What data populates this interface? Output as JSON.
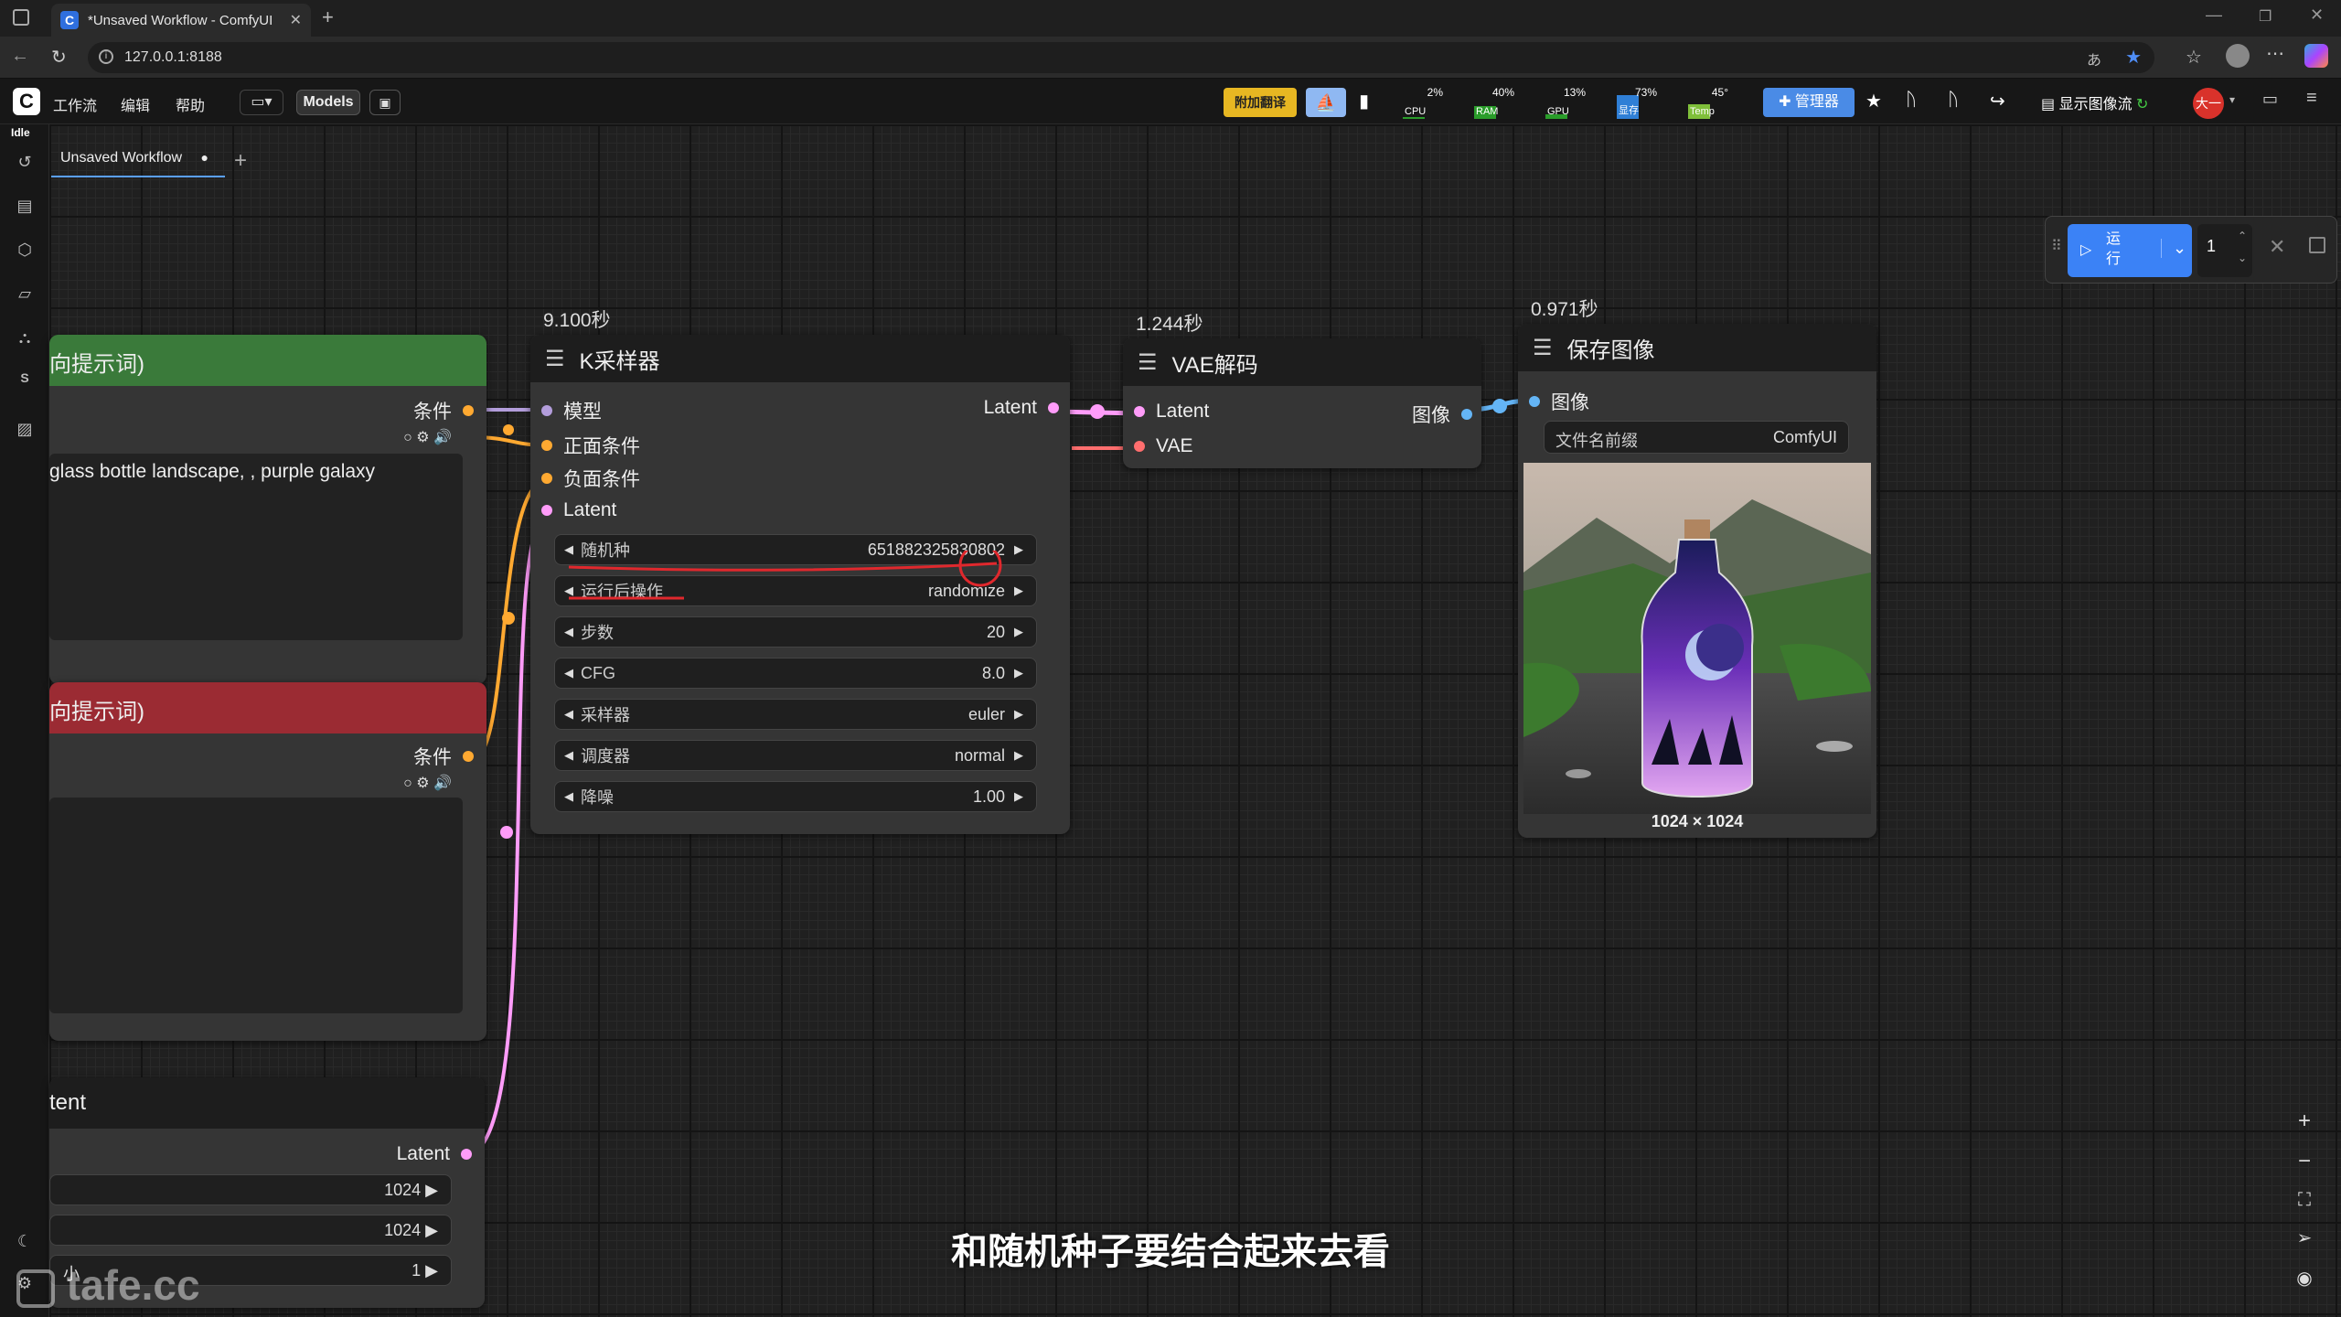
{
  "browser": {
    "tab_title": "*Unsaved Workflow - ComfyUI",
    "url": "127.0.0.1:8188"
  },
  "menubar": {
    "items": [
      "工作流",
      "编辑",
      "帮助"
    ],
    "models_label": "Models",
    "translate_label": "附加翻译",
    "manager_label": "管理器",
    "show_image_flow_label": "显示图像流",
    "monitors": [
      {
        "label": "CPU",
        "percent": "2%",
        "fill": 0.02,
        "color": "#2a9d2a"
      },
      {
        "label": "RAM",
        "percent": "40%",
        "fill": 0.4,
        "color": "#2a9d2a"
      },
      {
        "label": "GPU",
        "percent": "13%",
        "fill": 0.13,
        "color": "#2a9d2a"
      },
      {
        "label": "显存",
        "percent": "73%",
        "fill": 0.73,
        "color": "#2f7fd6"
      },
      {
        "label": "Temp",
        "percent": "45°",
        "fill": 0.45,
        "color": "#7fbf3a"
      }
    ],
    "avatar_text": "大一"
  },
  "status": {
    "idle": "Idle"
  },
  "workflow_tab": {
    "label": "Unsaved Workflow"
  },
  "run_panel": {
    "run_label": "运\n行",
    "count": "1"
  },
  "nodes": {
    "positive": {
      "title": "向提示词)",
      "output": "条件",
      "text": "glass bottle landscape, , purple galaxy"
    },
    "negative": {
      "title": "向提示词)",
      "output": "条件"
    },
    "latent": {
      "title": "tent",
      "output": "Latent",
      "width": "1024",
      "height": "1024",
      "batch_label": "小",
      "batch": "1"
    },
    "ksampler": {
      "timing": "9.100秒",
      "title": "K采样器",
      "inputs": [
        "模型",
        "正面条件",
        "负面条件",
        "Latent"
      ],
      "output": "Latent",
      "widgets": [
        {
          "name": "随机种",
          "value": "651882325830802"
        },
        {
          "name": "运行后操作",
          "value": "randomize"
        },
        {
          "name": "步数",
          "value": "20"
        },
        {
          "name": "CFG",
          "value": "8.0"
        },
        {
          "name": "采样器",
          "value": "euler"
        },
        {
          "name": "调度器",
          "value": "normal"
        },
        {
          "name": "降噪",
          "value": "1.00"
        }
      ]
    },
    "vae": {
      "timing": "1.244秒",
      "title": "VAE解码",
      "inputs": [
        "Latent",
        "VAE"
      ],
      "output": "图像"
    },
    "save": {
      "timing": "0.971秒",
      "title": "保存图像",
      "input": "图像",
      "prefix_label": "文件名前缀",
      "prefix_value": "ComfyUI",
      "dims": "1024 × 1024"
    }
  },
  "subtitle": "和随机种子要结合起来去看",
  "watermark": "tafe.cc",
  "colors": {
    "accent": "#3b82f6",
    "positive_header": "#3a7a3a",
    "negative_header": "#9b2b33",
    "model_slot": "#b39ddb",
    "cond_slot": "#ffa931",
    "latent_slot": "#ff9cf9",
    "vae_slot": "#ff6e6e",
    "image_slot": "#64b5f6"
  }
}
